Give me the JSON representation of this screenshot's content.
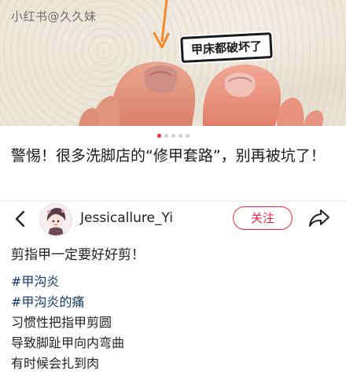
{
  "photo": {
    "watermark": "小红书@久久妹",
    "caption_tag": "甲床都破坏了",
    "carousel": {
      "count": 5,
      "active_index": 0
    }
  },
  "post": {
    "title": "警惕！很多洗脚店的“修甲套路”，别再被坑了！"
  },
  "author_bar": {
    "back_icon": "chevron-left-icon",
    "author_name": "Jessicallure_Yi",
    "follow_label": "关注",
    "share_icon": "share-arrow-icon"
  },
  "body": {
    "lead": "剪指甲一定要好好剪！",
    "tags": [
      "#甲沟炎",
      "#甲沟炎的痛"
    ],
    "lines": [
      "习惯性把指甲剪圆",
      "导致脚趾甲向内弯曲",
      "有时候会扎到肉"
    ]
  },
  "colors": {
    "accent": "#ff2442",
    "tag": "#13386c",
    "active_dot": "#ff2442",
    "inactive_dot": "#d0d0d0"
  }
}
